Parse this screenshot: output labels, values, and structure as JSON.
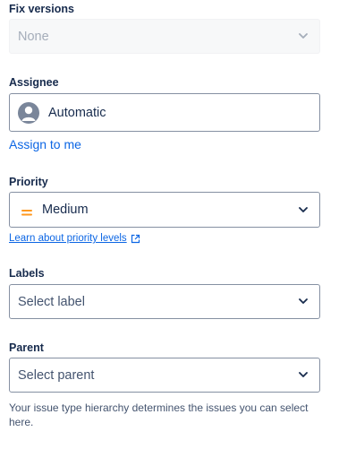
{
  "fix_versions": {
    "label": "Fix versions",
    "value": "None",
    "disabled": true,
    "icon": "chevron-down-icon"
  },
  "assignee": {
    "label": "Assignee",
    "value": "Automatic",
    "avatar_icon": "user-avatar-icon",
    "assign_to_me_label": "Assign to me"
  },
  "priority": {
    "label": "Priority",
    "value": "Medium",
    "icon": "priority-medium-icon",
    "icon_color": "#ff991f",
    "learn_link_label": "Learn about priority levels",
    "learn_link_icon": "external-link-icon"
  },
  "labels": {
    "label": "Labels",
    "placeholder": "Select label"
  },
  "parent": {
    "label": "Parent",
    "placeholder": "Select parent",
    "help_text": "Your issue type hierarchy determines the issues you can select here."
  },
  "colors": {
    "link": "#0c66e4",
    "text": "#172b4d",
    "border": "#8590a2"
  }
}
